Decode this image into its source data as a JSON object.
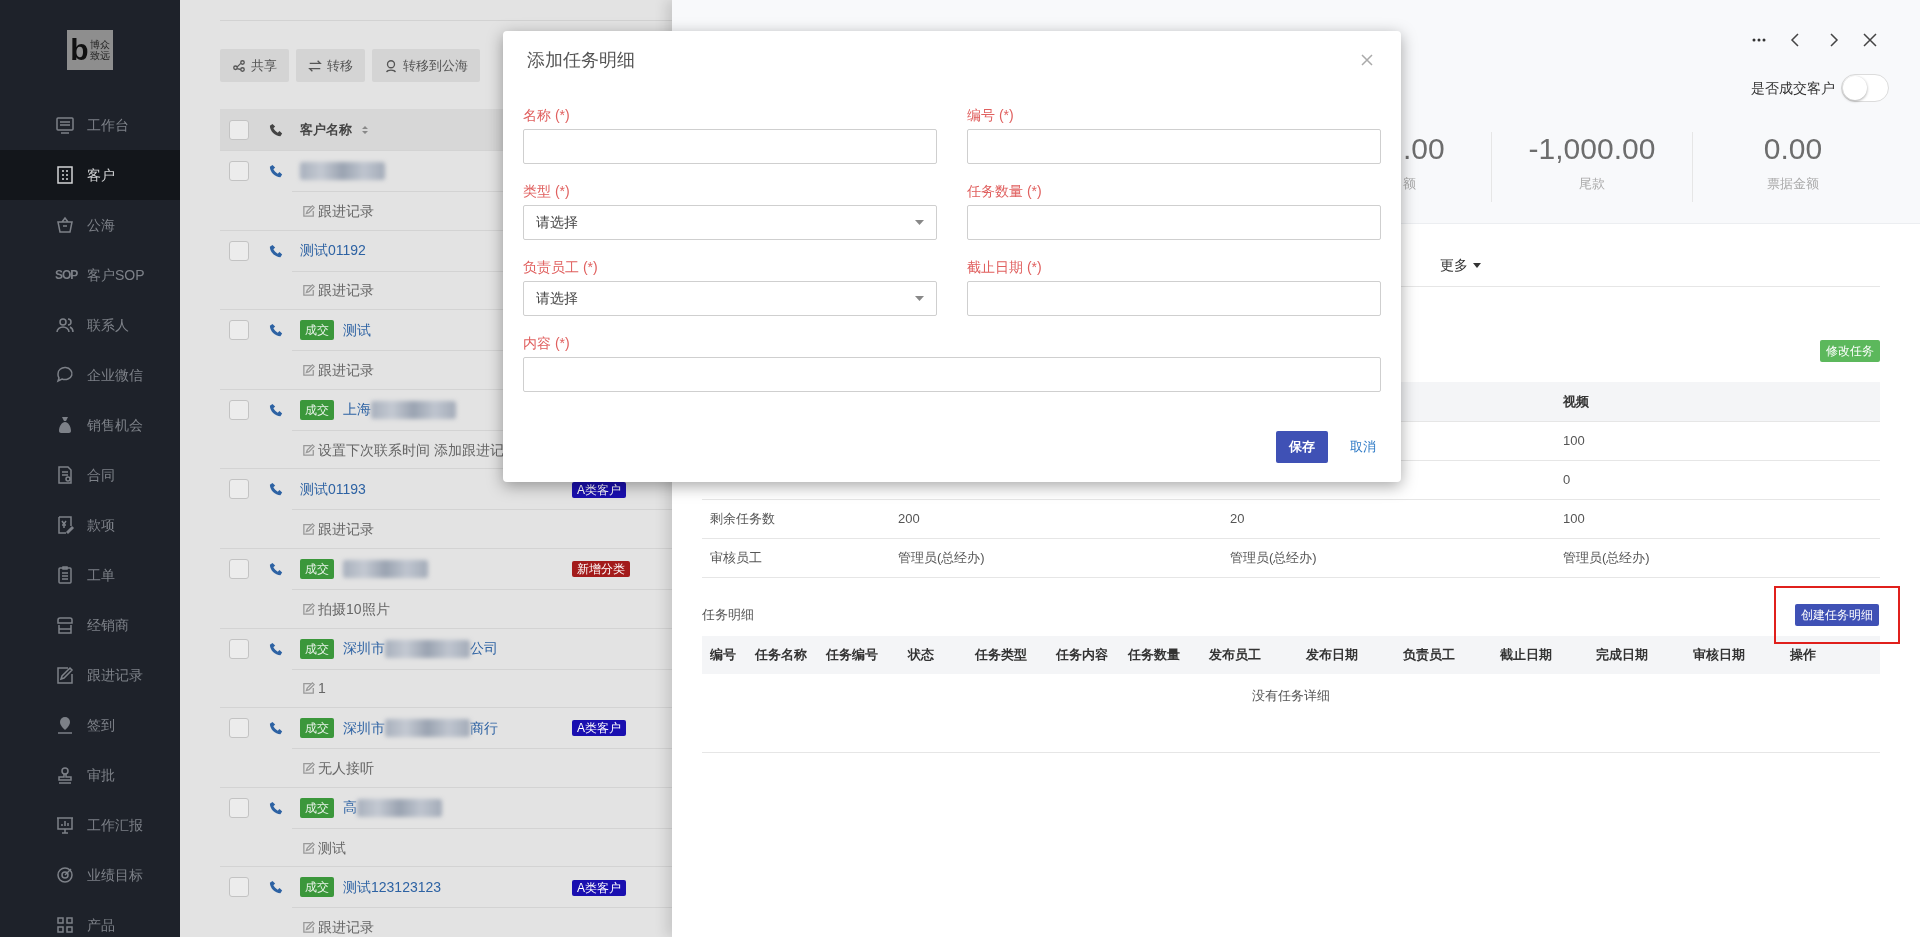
{
  "sidebar": {
    "logo": {
      "letter": "b",
      "lines": [
        "博众",
        "致远"
      ]
    },
    "items": [
      {
        "label": "工作台",
        "kind": "glyph",
        "selected": false
      },
      {
        "label": "客户",
        "kind": "glyph",
        "selected": true
      },
      {
        "label": "公海",
        "kind": "glyph",
        "selected": false
      },
      {
        "label": "客户SOP",
        "kind": "text_icon",
        "icon_text": "SOP",
        "selected": false
      },
      {
        "label": "联系人",
        "kind": "glyph",
        "selected": false
      },
      {
        "label": "企业微信",
        "kind": "glyph",
        "selected": false
      },
      {
        "label": "销售机会",
        "kind": "glyph",
        "selected": false
      },
      {
        "label": "合同",
        "kind": "glyph",
        "selected": false
      },
      {
        "label": "款项",
        "kind": "glyph",
        "selected": false
      },
      {
        "label": "工单",
        "kind": "glyph",
        "selected": false
      },
      {
        "label": "经销商",
        "kind": "glyph",
        "selected": false
      },
      {
        "label": "跟进记录",
        "kind": "glyph",
        "selected": false
      },
      {
        "label": "签到",
        "kind": "glyph",
        "selected": false
      },
      {
        "label": "审批",
        "kind": "glyph",
        "selected": false
      },
      {
        "label": "工作汇报",
        "kind": "glyph",
        "selected": false
      },
      {
        "label": "业绩目标",
        "kind": "glyph",
        "selected": false
      },
      {
        "label": "产品",
        "kind": "glyph",
        "selected": false
      }
    ]
  },
  "customer_list": {
    "toolbar": [
      {
        "label": "共享"
      },
      {
        "label": "转移"
      },
      {
        "label": "转移到公海"
      }
    ],
    "header": {
      "checked": false,
      "column": "客户名称"
    },
    "rows": [
      {
        "checked": false,
        "redacted": true,
        "note": "跟进记录"
      },
      {
        "checked": false,
        "name_start": "测试01192",
        "redacted": false,
        "note": "跟进记录"
      },
      {
        "checked": false,
        "deal": "成交",
        "name_start": "测试",
        "redacted": false,
        "note": "跟进记录"
      },
      {
        "checked": false,
        "deal": "成交",
        "name_start": "上海",
        "redacted": true,
        "note": "设置下次联系时间 添加跟进记"
      },
      {
        "checked": false,
        "name_start": "测试01193",
        "redacted": false,
        "category": {
          "label": "A类客户",
          "color": "#1a0fb0"
        },
        "note": "跟进记录"
      },
      {
        "checked": false,
        "deal": "成交",
        "redacted": true,
        "category": {
          "label": "新增分类",
          "color": "#a31b1b"
        },
        "note": "拍摄10照片"
      },
      {
        "checked": false,
        "deal": "成交",
        "name_start": "深圳市",
        "redacted": true,
        "name_end": "公司",
        "note": "1"
      },
      {
        "checked": false,
        "deal": "成交",
        "name_start": "深圳市",
        "redacted": true,
        "name_end": "商行",
        "category": {
          "label": "A类客户",
          "color": "#1a0fb0"
        },
        "note": "无人接听"
      },
      {
        "checked": false,
        "deal": "成交",
        "name_start": "高",
        "redacted": true,
        "note": "测试"
      },
      {
        "checked": false,
        "deal": "成交",
        "name_start": "测试123123123",
        "redacted": false,
        "category": {
          "label": "A类客户",
          "color": "#1a0fb0"
        },
        "note": "跟进记录"
      }
    ]
  },
  "drawer": {
    "deal_toggle": {
      "label": "是否成交客户",
      "on": false
    },
    "stats": [
      {
        "value": ".00",
        "label": "额"
      },
      {
        "value": "-1,000.00",
        "label": "尾款"
      },
      {
        "value": "0.00",
        "label": "票据金额"
      }
    ],
    "more_menu": "更多",
    "edit_button": "修改任务",
    "summary_table": {
      "header": {
        "column_4": "视频"
      },
      "rows": [
        {
          "column_4": "100"
        },
        {
          "column_4": "0"
        },
        {
          "column_1": "剩余任务数",
          "column_2": "200",
          "column_3": "20",
          "column_4": "100"
        },
        {
          "column_1": "审核员工",
          "column_2": "管理员(总经办)",
          "column_3": "管理员(总经办)",
          "column_4": "管理员(总经办)"
        }
      ]
    },
    "detail_section": {
      "title": "任务明细",
      "create_button": "创建任务明细",
      "highlighted": true,
      "columns": [
        "编号",
        "任务名称",
        "任务编号",
        "状态",
        "任务类型",
        "任务内容",
        "任务数量",
        "发布员工",
        "发布日期",
        "负责员工",
        "截止日期",
        "完成日期",
        "审核日期",
        "操作"
      ],
      "empty_text": "没有任务详细"
    }
  },
  "modal": {
    "title": "添加任务明细",
    "fields": [
      {
        "label": "名称 (*)",
        "kind": "text",
        "wide": false
      },
      {
        "label": "编号 (*)",
        "kind": "text",
        "wide": false
      },
      {
        "label": "类型 (*)",
        "kind": "select",
        "value": "请选择",
        "wide": false
      },
      {
        "label": "任务数量 (*)",
        "kind": "text",
        "wide": false
      },
      {
        "label": "负责员工 (*)",
        "kind": "select",
        "value": "请选择",
        "wide": false
      },
      {
        "label": "截止日期 (*)",
        "kind": "text",
        "wide": false
      },
      {
        "label": "内容 (*)",
        "kind": "text",
        "wide": true
      }
    ],
    "buttons": [
      {
        "label": "保存",
        "kind": "primary"
      },
      {
        "label": "取消",
        "kind": "link"
      }
    ]
  }
}
